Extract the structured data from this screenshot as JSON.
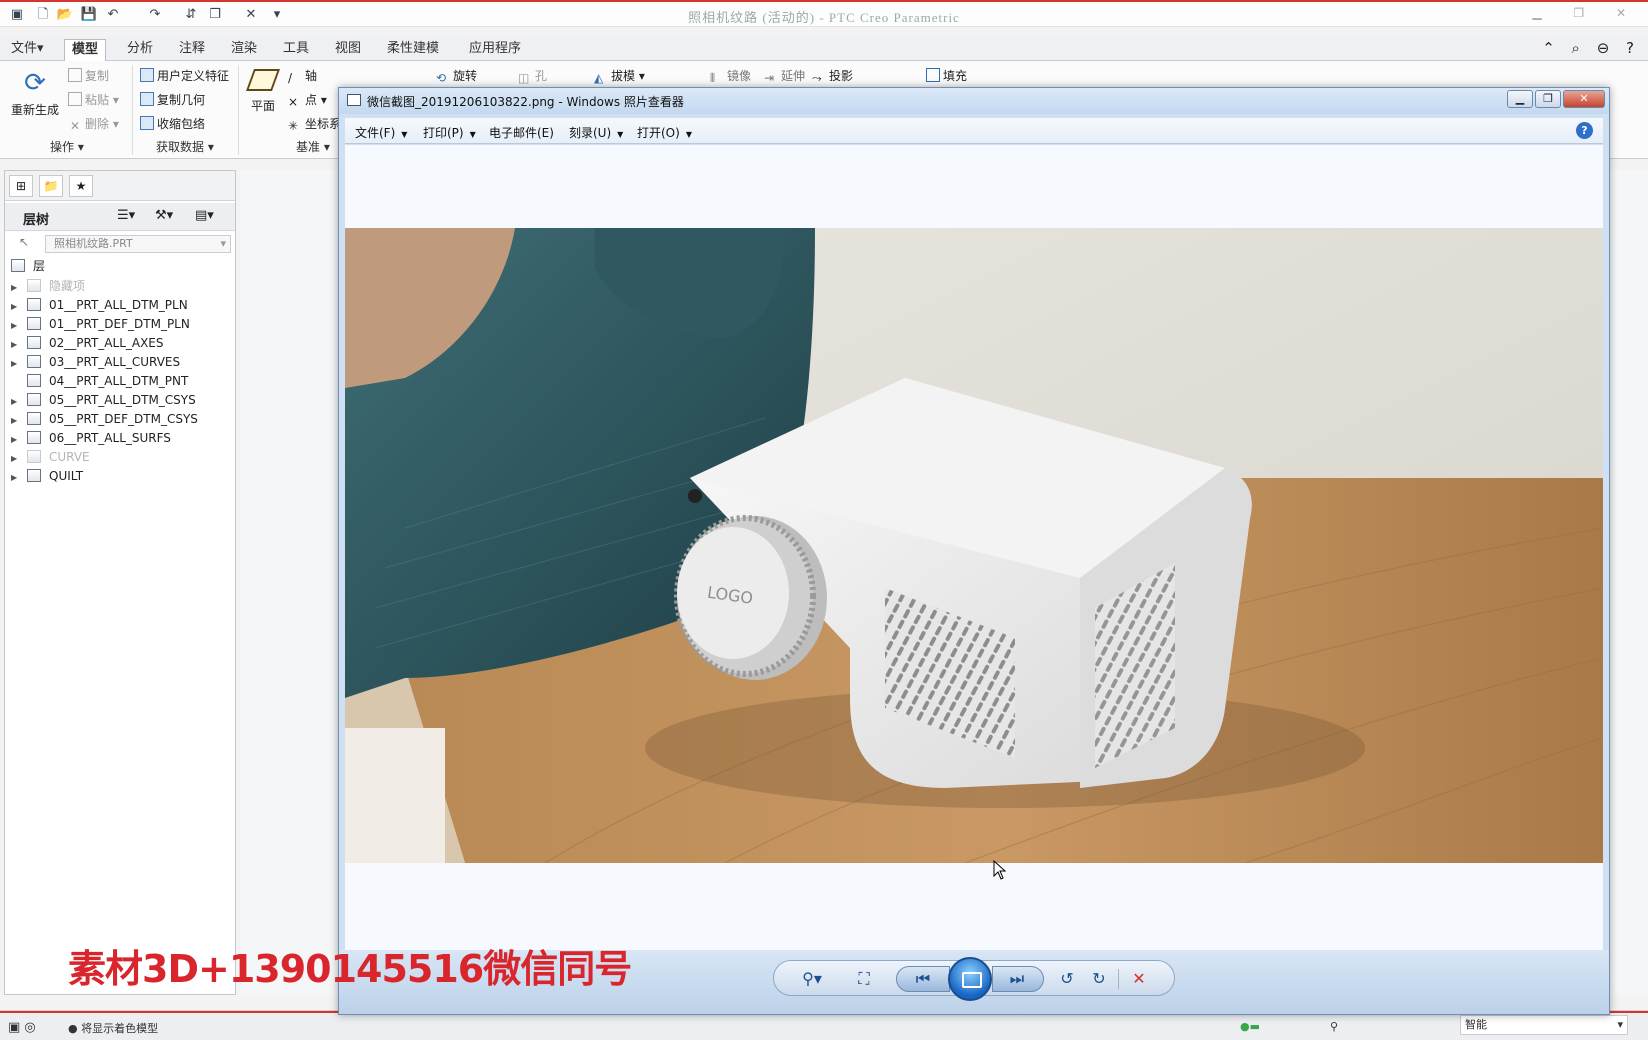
{
  "app": {
    "title": "照相机纹路 (活动的) - PTC Creo Parametric"
  },
  "ribbon": {
    "tabs": [
      "文件▾",
      "模型",
      "分析",
      "注释",
      "渲染",
      "工具",
      "视图",
      "柔性建模",
      "应用程序"
    ],
    "active_tab": "模型",
    "regen_label": "重新生成",
    "copy_label": "复制",
    "paste_label": "粘贴",
    "delete_label": "删除",
    "udf_label": "用户定义特征",
    "copy_geom_label": "复制几何",
    "shrinkwrap_label": "收缩包络",
    "plane_label": "平面",
    "axis_label": "轴",
    "point_label": "点",
    "csys_label": "坐标系",
    "revolve_label": "旋转",
    "hole_label": "孔",
    "draft_label": "拔模",
    "mirror_label": "镜像",
    "extend_label": "延伸",
    "project_label": "投影",
    "fill_label": "填充",
    "group_operations": "操作",
    "group_getdata": "获取数据",
    "group_datum": "基准"
  },
  "left_panel": {
    "header": "层树",
    "model_name": "照相机纹路.PRT",
    "root_label": "层",
    "layers": [
      {
        "name": "隐藏项",
        "dim": true
      },
      {
        "name": "01__PRT_ALL_DTM_PLN",
        "dim": false
      },
      {
        "name": "01__PRT_DEF_DTM_PLN",
        "dim": false
      },
      {
        "name": "02__PRT_ALL_AXES",
        "dim": false
      },
      {
        "name": "03__PRT_ALL_CURVES",
        "dim": false
      },
      {
        "name": "04__PRT_ALL_DTM_PNT",
        "dim": false
      },
      {
        "name": "05__PRT_ALL_DTM_CSYS",
        "dim": false
      },
      {
        "name": "05__PRT_DEF_DTM_CSYS",
        "dim": false
      },
      {
        "name": "06__PRT_ALL_SURFS",
        "dim": false
      },
      {
        "name": "CURVE",
        "dim": true
      },
      {
        "name": "QUILT",
        "dim": false
      }
    ]
  },
  "viewer": {
    "title": "微信截图_20191206103822.png - Windows 照片查看器",
    "menu": [
      "文件(F)",
      "打印(P)",
      "电子邮件(E)",
      "刻录(U)",
      "打开(O)"
    ],
    "help": "?",
    "logo_text": "LOGO"
  },
  "status": {
    "message": "将显示着色模型",
    "filter": "智能"
  },
  "watermark": "素材3D+1390145516微信同号",
  "colors": {
    "accent_red": "#d6342c",
    "viewer_frame": "#cfe0f2",
    "watermark": "#d9262d"
  }
}
